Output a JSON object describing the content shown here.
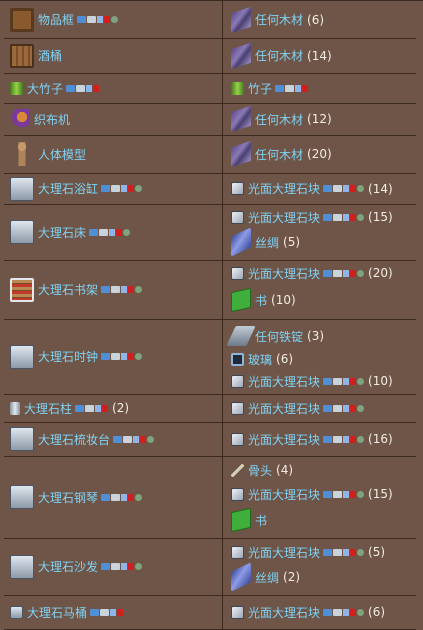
{
  "colors": {
    "background": "#6f5547",
    "link": "#7fd3f6",
    "text": "#f2ece4"
  },
  "rows": [
    {
      "name": "物品框",
      "icon": "item-frame-icon",
      "badges": [
        "b1",
        "b2",
        "b3",
        "b4",
        "b5"
      ],
      "ingredients": [
        {
          "name": "任何木材",
          "count": "(6)",
          "icon": "wood-icon"
        }
      ]
    },
    {
      "name": "酒桶",
      "icon": "keg-icon",
      "badges": [],
      "ingredients": [
        {
          "name": "任何木材",
          "count": "(14)",
          "icon": "wood-icon"
        }
      ]
    },
    {
      "name": "大竹子",
      "icon": "large-bamboo-icon",
      "badges": [
        "b1",
        "b2",
        "b3",
        "b4"
      ],
      "ingredients": [
        {
          "name": "竹子",
          "count": "",
          "icon": "bamboo-icon",
          "badges": [
            "b1",
            "b2",
            "b3",
            "b4"
          ]
        }
      ]
    },
    {
      "name": "织布机",
      "icon": "loom-icon",
      "badges": [],
      "ingredients": [
        {
          "name": "任何木材",
          "count": "(12)",
          "icon": "wood-icon"
        }
      ]
    },
    {
      "name": "人体模型",
      "icon": "mannequin-icon",
      "badges": [],
      "ingredients": [
        {
          "name": "任何木材",
          "count": "(20)",
          "icon": "wood-icon"
        }
      ]
    },
    {
      "name": "大理石浴缸",
      "icon": "marble-bathtub-icon",
      "badges": [
        "b1",
        "b2",
        "b3",
        "b4",
        "b5"
      ],
      "ingredients": [
        {
          "name": "光面大理石块",
          "count": "(14)",
          "icon": "marble-block-icon",
          "badges": [
            "b1",
            "b2",
            "b3",
            "b4",
            "b5"
          ]
        }
      ]
    },
    {
      "name": "大理石床",
      "icon": "marble-bed-icon",
      "badges": [
        "b1",
        "b2",
        "b3",
        "b4",
        "b5"
      ],
      "ingredients": [
        {
          "name": "光面大理石块",
          "count": "(15)",
          "icon": "marble-block-icon",
          "badges": [
            "b1",
            "b2",
            "b3",
            "b4",
            "b5"
          ]
        },
        {
          "name": "丝绸",
          "count": "(5)",
          "icon": "silk-icon"
        }
      ]
    },
    {
      "name": "大理石书架",
      "icon": "marble-bookcase-icon",
      "badges": [
        "b1",
        "b2",
        "b3",
        "b4",
        "b5"
      ],
      "ingredients": [
        {
          "name": "光面大理石块",
          "count": "(20)",
          "icon": "marble-block-icon",
          "badges": [
            "b1",
            "b2",
            "b3",
            "b4",
            "b5"
          ]
        },
        {
          "name": "书",
          "count": "(10)",
          "icon": "book-icon"
        }
      ]
    },
    {
      "name": "大理石时钟",
      "icon": "marble-clock-icon",
      "badges": [
        "b1",
        "b2",
        "b3",
        "b4",
        "b5"
      ],
      "ingredients": [
        {
          "name": "任何铁锭",
          "count": "(3)",
          "icon": "iron-bar-icon"
        },
        {
          "name": "玻璃",
          "count": "(6)",
          "icon": "glass-icon"
        },
        {
          "name": "光面大理石块",
          "count": "(10)",
          "icon": "marble-block-icon",
          "badges": [
            "b1",
            "b2",
            "b3",
            "b4",
            "b5"
          ]
        }
      ]
    },
    {
      "name": "大理石柱",
      "icon": "marble-column-icon",
      "badges": [
        "b1",
        "b2",
        "b3",
        "b4"
      ],
      "count": "(2)",
      "ingredients": [
        {
          "name": "光面大理石块",
          "count": "",
          "icon": "marble-block-icon",
          "badges": [
            "b1",
            "b2",
            "b3",
            "b4",
            "b5"
          ]
        }
      ]
    },
    {
      "name": "大理石梳妆台",
      "icon": "marble-dresser-icon",
      "badges": [
        "b1",
        "b2",
        "b3",
        "b4",
        "b5"
      ],
      "ingredients": [
        {
          "name": "光面大理石块",
          "count": "(16)",
          "icon": "marble-block-icon",
          "badges": [
            "b1",
            "b2",
            "b3",
            "b4",
            "b5"
          ]
        }
      ]
    },
    {
      "name": "大理石钢琴",
      "icon": "marble-piano-icon",
      "badges": [
        "b1",
        "b2",
        "b3",
        "b4",
        "b5"
      ],
      "ingredients": [
        {
          "name": "骨头",
          "count": "(4)",
          "icon": "bone-icon"
        },
        {
          "name": "光面大理石块",
          "count": "(15)",
          "icon": "marble-block-icon",
          "badges": [
            "b1",
            "b2",
            "b3",
            "b4",
            "b5"
          ]
        },
        {
          "name": "书",
          "count": "",
          "icon": "book-icon"
        }
      ]
    },
    {
      "name": "大理石沙发",
      "icon": "marble-sofa-icon",
      "badges": [
        "b1",
        "b2",
        "b3",
        "b4",
        "b5"
      ],
      "ingredients": [
        {
          "name": "光面大理石块",
          "count": "(5)",
          "icon": "marble-block-icon",
          "badges": [
            "b1",
            "b2",
            "b3",
            "b4",
            "b5"
          ]
        },
        {
          "name": "丝绸",
          "count": "(2)",
          "icon": "silk-icon"
        }
      ]
    },
    {
      "name": "大理石马桶",
      "icon": "marble-toilet-icon",
      "badges": [
        "b1",
        "b2",
        "b3",
        "b4"
      ],
      "ingredients": [
        {
          "name": "光面大理石块",
          "count": "(6)",
          "icon": "marble-block-icon",
          "badges": [
            "b1",
            "b2",
            "b3",
            "b4",
            "b5"
          ]
        }
      ]
    }
  ]
}
